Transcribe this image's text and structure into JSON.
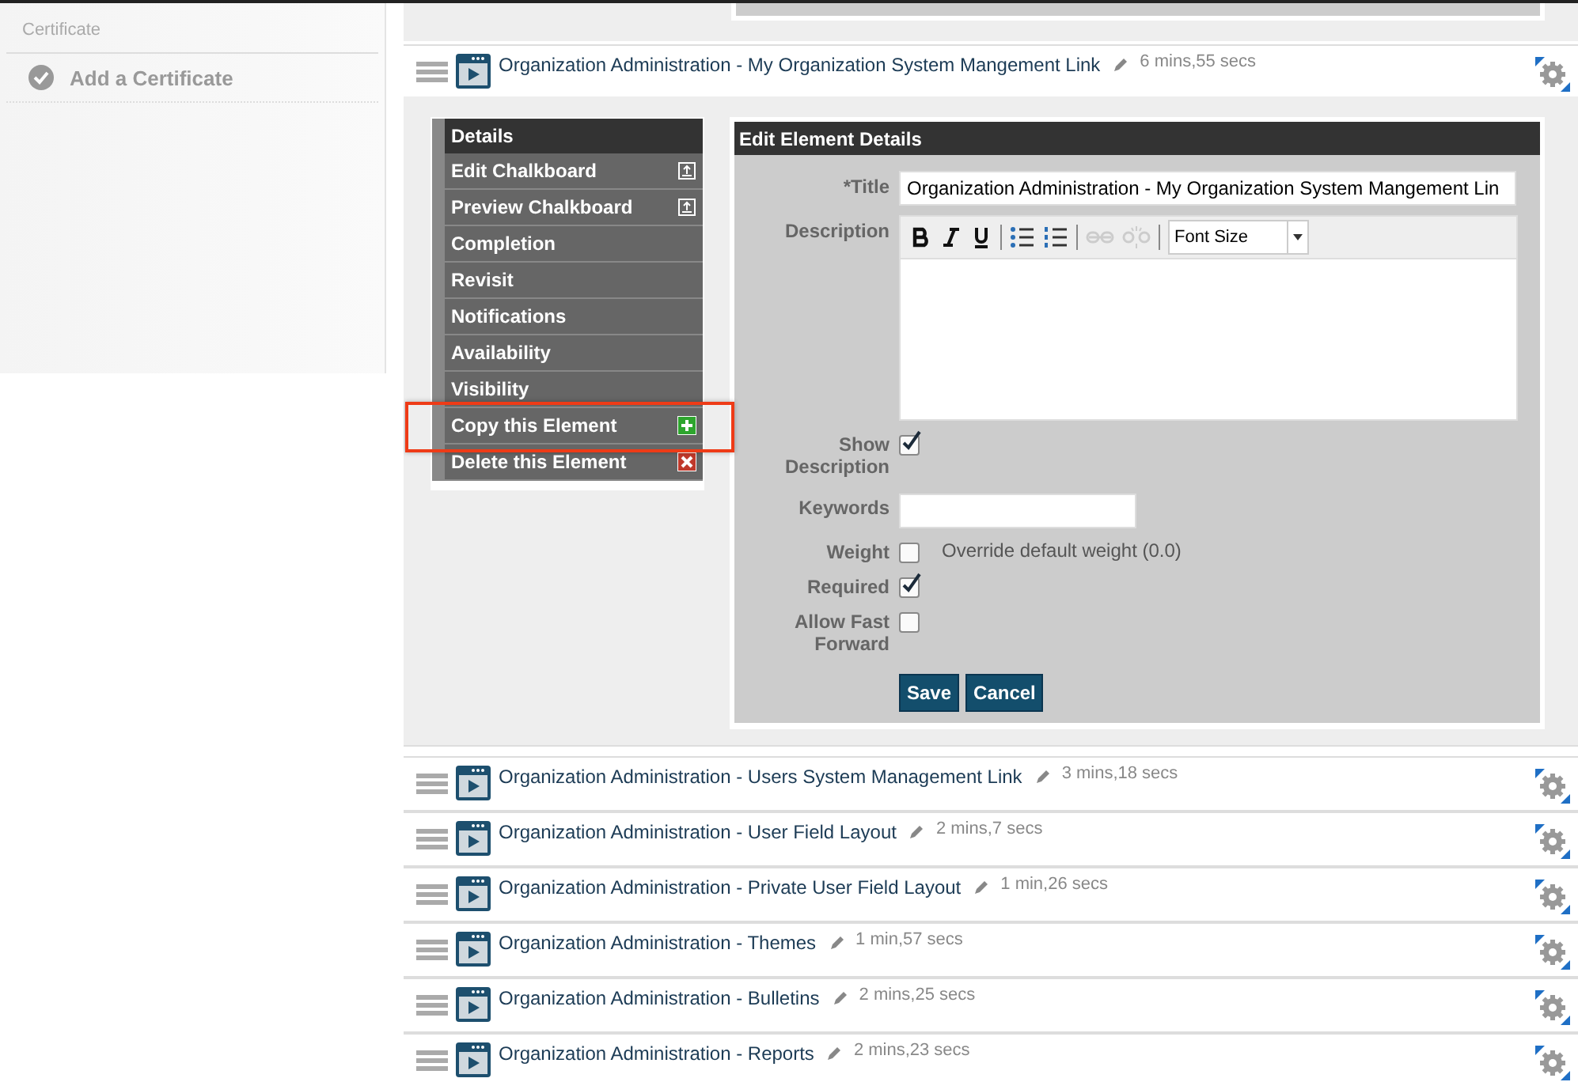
{
  "sidebar": {
    "heading": "Certificate",
    "items": [
      {
        "label": "Add a Certificate"
      }
    ]
  },
  "elements": [
    {
      "title": "Organization Administration - My Organization System Mangement Link",
      "duration": "6 mins,55 secs",
      "expanded": true
    },
    {
      "title": "Organization Administration - Users System Management Link",
      "duration": "3 mins,18 secs",
      "expanded": false
    },
    {
      "title": "Organization Administration - User Field Layout",
      "duration": "2 mins,7 secs",
      "expanded": false
    },
    {
      "title": "Organization Administration - Private User Field Layout",
      "duration": "1 min,26 secs",
      "expanded": false
    },
    {
      "title": "Organization Administration - Themes",
      "duration": "1 min,57 secs",
      "expanded": false
    },
    {
      "title": "Organization Administration - Bulletins",
      "duration": "2 mins,25 secs",
      "expanded": false
    },
    {
      "title": "Organization Administration - Reports",
      "duration": "2 mins,23 secs",
      "expanded": false
    }
  ],
  "menu": {
    "heading": "Details",
    "items": [
      {
        "label": "Edit Chalkboard",
        "kind": "popup",
        "highlighted": false
      },
      {
        "label": "Preview Chalkboard",
        "kind": "popup",
        "highlighted": false
      },
      {
        "label": "Completion",
        "kind": "plain",
        "highlighted": false
      },
      {
        "label": "Revisit",
        "kind": "plain",
        "highlighted": false
      },
      {
        "label": "Notifications",
        "kind": "plain",
        "highlighted": false
      },
      {
        "label": "Availability",
        "kind": "plain",
        "highlighted": false
      },
      {
        "label": "Visibility",
        "kind": "plain",
        "highlighted": false
      },
      {
        "label": "Copy this Element",
        "kind": "add",
        "highlighted": true
      },
      {
        "label": "Delete this Element",
        "kind": "delete",
        "highlighted": false
      }
    ]
  },
  "form": {
    "heading": "Edit Element Details",
    "fields": [
      {
        "kind": "text",
        "label": "*Title",
        "value": "Organization Administration - My Organization System Mangement Lin"
      },
      {
        "kind": "editor",
        "label": "Description",
        "font_size": "Font Size"
      },
      {
        "kind": "checkbox",
        "label": "Show Description",
        "checked": true
      },
      {
        "kind": "short",
        "label": "Keywords"
      },
      {
        "kind": "checkbox",
        "label": "Weight",
        "checked": false,
        "option": "Override default weight (0.0)"
      },
      {
        "kind": "checkbox",
        "label": "Required",
        "checked": true
      },
      {
        "kind": "checkbox",
        "label": "Allow Fast Forward",
        "checked": false
      }
    ],
    "buttons": [
      "Save",
      "Cancel"
    ]
  }
}
